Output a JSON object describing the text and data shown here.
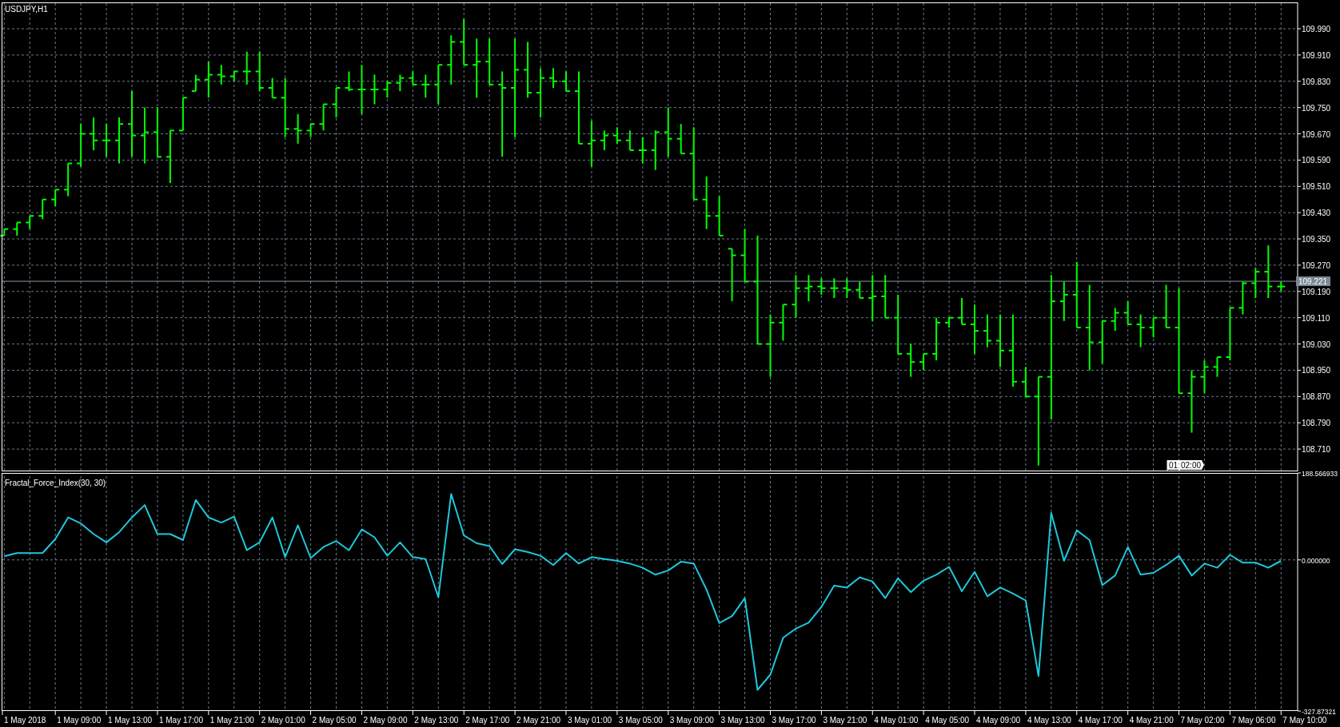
{
  "price_chart": {
    "symbol_label": "USDJPY,H1",
    "price_axis_labels": [
      "109.990",
      "109.910",
      "109.830",
      "109.750",
      "109.670",
      "109.590",
      "109.510",
      "109.430",
      "109.350",
      "109.270",
      "109.190",
      "109.110",
      "109.030",
      "108.950",
      "108.870",
      "108.790",
      "108.710"
    ],
    "current_price": "109.221",
    "time_marker": [
      "01:",
      "02:00"
    ]
  },
  "indicator_panel": {
    "chart_data": {
      "type": "line",
      "grid": true,
      "ylim": [
        -327.87321,
        188.566933
      ],
      "yticks": [
        {
          "value": 188.566933,
          "label": "188.566933"
        },
        {
          "value": 0,
          "label": "0.000000"
        },
        {
          "value": -327.87321,
          "label": "-327.87321"
        }
      ],
      "series": [
        {
          "name": "Fractal_Force_Index(30, 30)",
          "color": "#1ec8dc",
          "values": [
            8,
            15,
            15,
            15,
            45,
            92,
            79,
            56,
            38,
            60,
            92,
            119,
            56,
            56,
            43,
            130,
            92,
            81,
            94,
            21,
            38,
            92,
            6,
            75,
            4,
            28,
            41,
            21,
            66,
            49,
            9,
            38,
            6,
            2,
            -81,
            143,
            53,
            36,
            30,
            -9,
            23,
            17,
            9,
            -11,
            15,
            -8,
            6,
            2,
            -2,
            -8,
            -17,
            -32,
            -23,
            -4,
            -8,
            -64,
            -137,
            -122,
            -83,
            -282,
            -249,
            -169,
            -149,
            -136,
            -102,
            -56,
            -60,
            -38,
            -47,
            -83,
            -40,
            -70,
            -45,
            -32,
            -15,
            -68,
            -26,
            -79,
            -60,
            -73,
            -88,
            -252,
            102,
            -2,
            64,
            43,
            -55,
            -34,
            28,
            -32,
            -28,
            -11,
            9,
            -34,
            -8,
            -17,
            11,
            -6,
            -6,
            -17,
            -2
          ]
        }
      ]
    }
  },
  "time_axis_labels": [
    "1 May 2018",
    "1 May 09:00",
    "1 May 13:00",
    "1 May 17:00",
    "1 May 21:00",
    "2 May 01:00",
    "2 May 05:00",
    "2 May 09:00",
    "2 May 13:00",
    "2 May 17:00",
    "2 May 21:00",
    "3 May 01:00",
    "3 May 05:00",
    "3 May 09:00",
    "3 May 13:00",
    "3 May 17:00",
    "3 May 21:00",
    "4 May 01:00",
    "4 May 05:00",
    "4 May 09:00",
    "4 May 13:00",
    "4 May 17:00",
    "4 May 21:00",
    "7 May 02:00",
    "7 May 06:00",
    "7 May 10:00"
  ]
}
